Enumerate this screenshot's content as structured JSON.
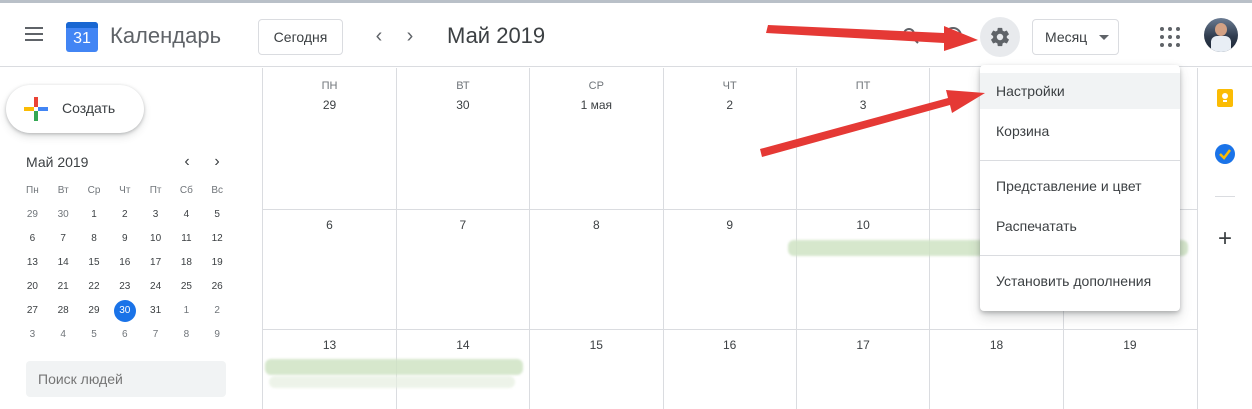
{
  "header": {
    "app_title": "Календарь",
    "logo_day": "31",
    "today_label": "Сегодня",
    "period": "Май 2019",
    "view_label": "Месяц"
  },
  "sidebar": {
    "create_label": "Создать",
    "mini_calendar": {
      "title": "Май 2019",
      "weekdays": [
        "Пн",
        "Вт",
        "Ср",
        "Чт",
        "Пт",
        "Сб",
        "Вс"
      ],
      "weeks": [
        [
          "29",
          "30",
          "1",
          "2",
          "3",
          "4",
          "5"
        ],
        [
          "6",
          "7",
          "8",
          "9",
          "10",
          "11",
          "12"
        ],
        [
          "13",
          "14",
          "15",
          "16",
          "17",
          "18",
          "19"
        ],
        [
          "20",
          "21",
          "22",
          "23",
          "24",
          "25",
          "26"
        ],
        [
          "27",
          "28",
          "29",
          "30",
          "31",
          "1",
          "2"
        ],
        [
          "3",
          "4",
          "5",
          "6",
          "7",
          "8",
          "9"
        ]
      ],
      "today": "30"
    },
    "people_search_placeholder": "Поиск людей"
  },
  "month_grid": {
    "weekdays": [
      "ПН",
      "ВТ",
      "СР",
      "ЧТ",
      "ПТ"
    ],
    "week1": [
      "29",
      "30",
      "1 мая",
      "2",
      "3"
    ],
    "week2": [
      "6",
      "7",
      "8",
      "9",
      "10"
    ],
    "week3": [
      "13",
      "14",
      "15",
      "16",
      "17",
      "18",
      "19"
    ]
  },
  "settings_menu": {
    "items": [
      "Настройки",
      "Корзина",
      "Представление и цвет",
      "Распечатать",
      "Установить дополнения"
    ]
  },
  "colors": {
    "accent": "#1a73e8",
    "annotation_arrow": "#e53935",
    "event": "#cfe3c4"
  },
  "icons": [
    "menu-icon",
    "calendar-logo-icon",
    "chevron-left-icon",
    "chevron-right-icon",
    "search-icon",
    "help-icon",
    "gear-icon",
    "caret-down-icon",
    "apps-icon",
    "keep-icon",
    "tasks-icon",
    "plus-icon"
  ]
}
